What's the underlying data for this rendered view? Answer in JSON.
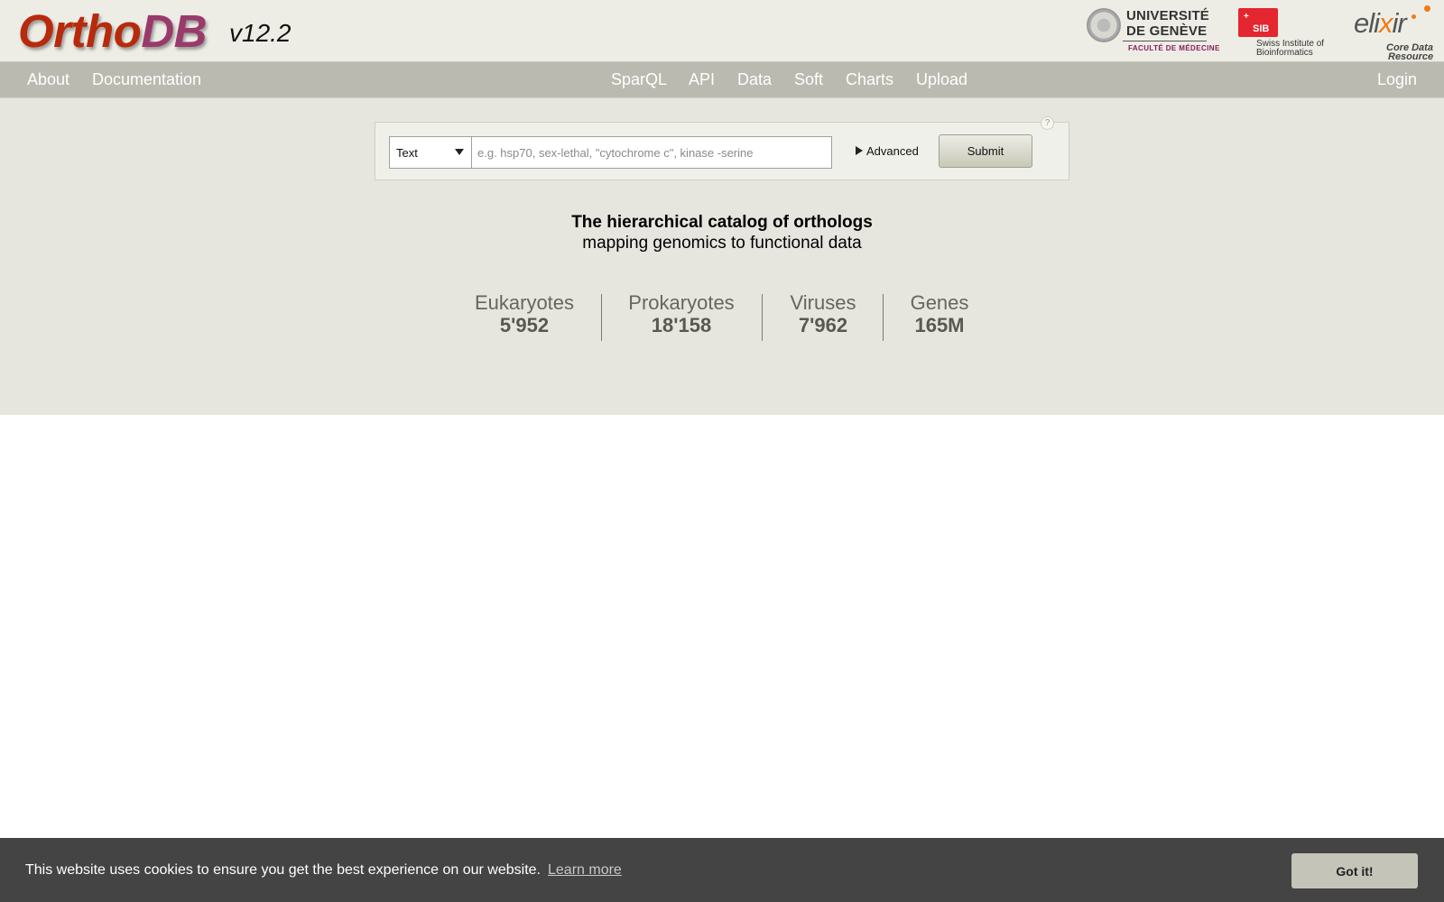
{
  "header": {
    "logo_part1": "Ortho",
    "logo_part2": "DB",
    "version": "v12.2",
    "partners": {
      "unige_line1": "UNIVERSITÉ",
      "unige_line2": "DE GENÈVE",
      "unige_line3": "FACULTÉ DE MÉDECINE",
      "sib_badge": "SIB",
      "sib_line1": "Swiss Institute of",
      "sib_line2": "Bioinformatics",
      "elixir_word_a": "eli",
      "elixir_word_x": "x",
      "elixir_word_b": "ir",
      "elixir_line1": "Core Data",
      "elixir_line2": "Resource"
    }
  },
  "nav": {
    "left": [
      "About",
      "Documentation"
    ],
    "center": [
      "SparQL",
      "API",
      "Data",
      "Soft",
      "Charts",
      "Upload"
    ],
    "right": "Login"
  },
  "search": {
    "type_selected": "Text",
    "placeholder": "e.g. hsp70, sex-lethal, \"cytochrome c\", kinase -serine",
    "value": "",
    "advanced_label": "Advanced",
    "submit_label": "Submit",
    "help_label": "?"
  },
  "tagline": {
    "title": "The hierarchical catalog of orthologs",
    "subtitle": "mapping genomics to functional data"
  },
  "stats": [
    {
      "label": "Eukaryotes",
      "value": "5'952"
    },
    {
      "label": "Prokaryotes",
      "value": "18'158"
    },
    {
      "label": "Viruses",
      "value": "7'962"
    },
    {
      "label": "Genes",
      "value": "165M"
    }
  ],
  "cookie": {
    "message": "This website uses cookies to ensure you get the best experience on our website.",
    "learn_more": "Learn more",
    "accept": "Got it!"
  },
  "colors": {
    "header_bg": "#edede6",
    "nav_bg": "#babab0",
    "main_bg": "#e6e6df",
    "logo_ortho": "#b82a0c",
    "logo_db": "#9a3a6b",
    "cookie_bg": "#444444"
  }
}
